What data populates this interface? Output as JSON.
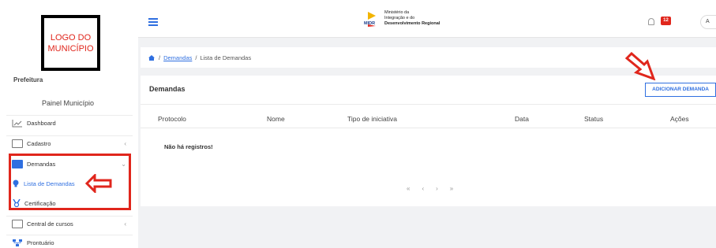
{
  "sidebar": {
    "logo_text": "LOGO DO\nMUNICÍPIO",
    "prefeitura": "Prefeitura",
    "painel": "Painel Município",
    "items": [
      {
        "label": "Dashboard",
        "icon": "chart-line-icon"
      },
      {
        "label": "Cadastro",
        "icon": "folder-icon",
        "chevron": "‹"
      },
      {
        "label": "Demandas",
        "icon": "folder-open-icon",
        "chevron": "⌄"
      },
      {
        "label": "Central de cursos",
        "icon": "folder-icon",
        "chevron": "‹"
      },
      {
        "label": "Prontuário",
        "icon": "sitemap-icon"
      }
    ],
    "subitems": [
      {
        "label": "Lista de Demandas",
        "icon": "lightbulb-icon",
        "active": true
      },
      {
        "label": "Certificação",
        "icon": "medal-icon"
      }
    ]
  },
  "topbar": {
    "brand_short": "MIDR",
    "brand_lines": [
      "Ministério da",
      "Integração e do",
      "Desenvolvimento Regional"
    ],
    "notification_count": "12",
    "avatar_letter": "A"
  },
  "breadcrumb": {
    "link": "Demandas",
    "separator": "/",
    "current": "Lista de Demandas"
  },
  "card": {
    "title": "Demandas",
    "add_button": "ADICIONAR DEMANDA",
    "columns": [
      "Protocolo",
      "Nome",
      "Tipo de iniciativa",
      "Data",
      "Status",
      "Ações"
    ],
    "empty_message": "Não há registros!",
    "pager": [
      "«",
      "‹",
      "›",
      "»"
    ]
  },
  "colors": {
    "accent": "#2f6fe0",
    "highlight": "#e0261c",
    "background": "#f1f2f4"
  }
}
